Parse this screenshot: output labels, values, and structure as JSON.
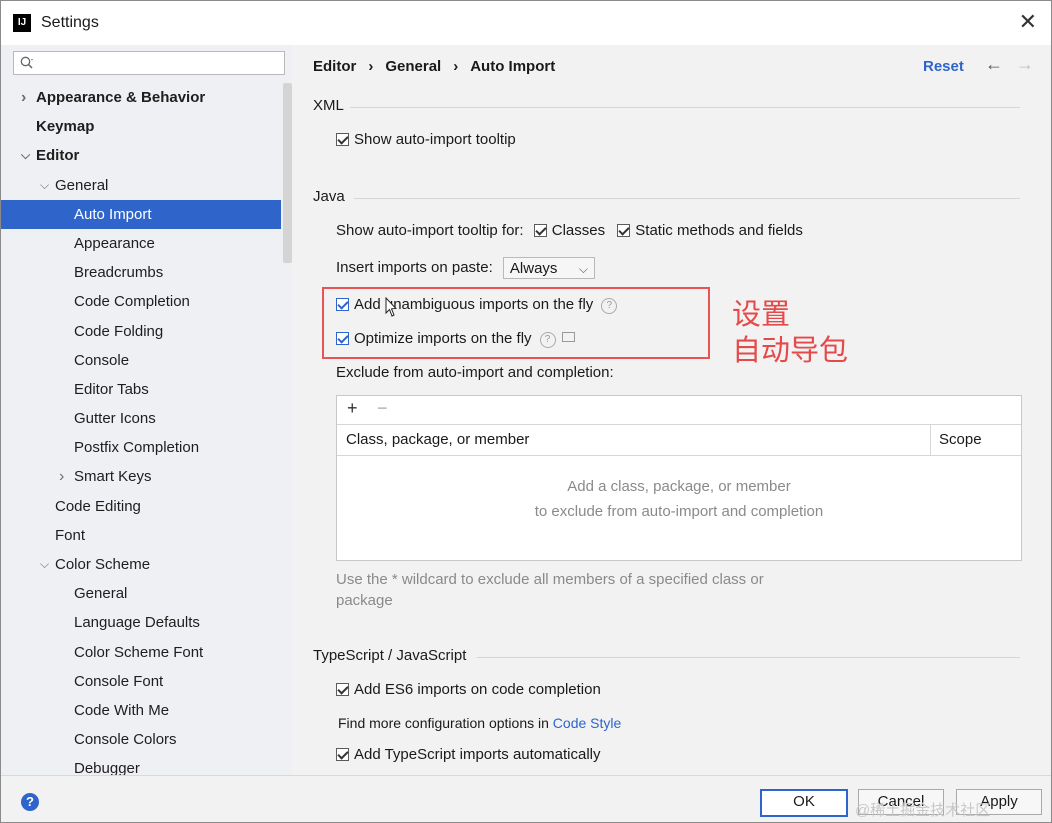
{
  "window": {
    "title": "Settings",
    "app_icon": "IJ"
  },
  "search": {
    "placeholder": ""
  },
  "sidebar": {
    "items": [
      {
        "label": "Appearance & Behavior",
        "level": 0,
        "bold": true,
        "arrow": "collapsed"
      },
      {
        "label": "Keymap",
        "level": 0,
        "bold": true
      },
      {
        "label": "Editor",
        "level": 0,
        "bold": true,
        "arrow": "expanded"
      },
      {
        "label": "General",
        "level": 1,
        "arrow": "expanded"
      },
      {
        "label": "Auto Import",
        "level": 2,
        "selected": true
      },
      {
        "label": "Appearance",
        "level": 2
      },
      {
        "label": "Breadcrumbs",
        "level": 2
      },
      {
        "label": "Code Completion",
        "level": 2
      },
      {
        "label": "Code Folding",
        "level": 2
      },
      {
        "label": "Console",
        "level": 2
      },
      {
        "label": "Editor Tabs",
        "level": 2
      },
      {
        "label": "Gutter Icons",
        "level": 2
      },
      {
        "label": "Postfix Completion",
        "level": 2
      },
      {
        "label": "Smart Keys",
        "level": 2,
        "arrow": "collapsed"
      },
      {
        "label": "Code Editing",
        "level": 1
      },
      {
        "label": "Font",
        "level": 1
      },
      {
        "label": "Color Scheme",
        "level": 1,
        "arrow": "expanded"
      },
      {
        "label": "General",
        "level": 2
      },
      {
        "label": "Language Defaults",
        "level": 2
      },
      {
        "label": "Color Scheme Font",
        "level": 2
      },
      {
        "label": "Console Font",
        "level": 2
      },
      {
        "label": "Code With Me",
        "level": 2
      },
      {
        "label": "Console Colors",
        "level": 2
      },
      {
        "label": "Debugger",
        "level": 2
      }
    ]
  },
  "header": {
    "breadcrumb": [
      "Editor",
      "General",
      "Auto Import"
    ],
    "separator": "›",
    "reset_label": "Reset",
    "back_glyph": "←",
    "forward_glyph": "→"
  },
  "xml": {
    "title": "XML",
    "show_tooltip": {
      "label": "Show auto-import tooltip",
      "checked": true
    }
  },
  "java": {
    "title": "Java",
    "tooltip_for_label": "Show auto-import tooltip for:",
    "classes": {
      "label": "Classes",
      "checked": true
    },
    "static_methods": {
      "label": "Static methods and fields",
      "checked": true
    },
    "insert_on_paste_label": "Insert imports on paste:",
    "insert_on_paste_value": "Always",
    "add_unambiguous": {
      "label": "Add unambiguous imports on the fly",
      "checked": true
    },
    "optimize_imports": {
      "label": "Optimize imports on the fly",
      "checked": true
    },
    "help_glyph": "?",
    "exclude_label": "Exclude from auto-import and completion:",
    "table": {
      "add_glyph": "+",
      "remove_glyph": "−",
      "columns": [
        "Class, package, or member",
        "Scope"
      ],
      "empty_line1": "Add a class, package, or member",
      "empty_line2": "to exclude from auto-import and completion"
    },
    "hint": "Use the * wildcard to exclude all members of a specified class or package"
  },
  "annotation": {
    "line1": "设置",
    "line2": "自动导包",
    "color": "#e54a4a"
  },
  "typescript": {
    "title": "TypeScript / JavaScript",
    "es6": {
      "label": "Add ES6 imports on code completion",
      "checked": true
    },
    "more_prefix": "Find more configuration options in",
    "more_link": "Code Style",
    "ts_auto": {
      "label": "Add TypeScript imports automatically",
      "checked": true
    }
  },
  "footer": {
    "help_glyph": "?",
    "ok_label": "OK",
    "cancel_label": "Cancel",
    "apply_label": "Apply",
    "watermark": "@稀土掘金技术社区"
  },
  "colors": {
    "accent": "#2f65ca",
    "selection": "#2f65ca",
    "annotation_red": "#e85454"
  }
}
